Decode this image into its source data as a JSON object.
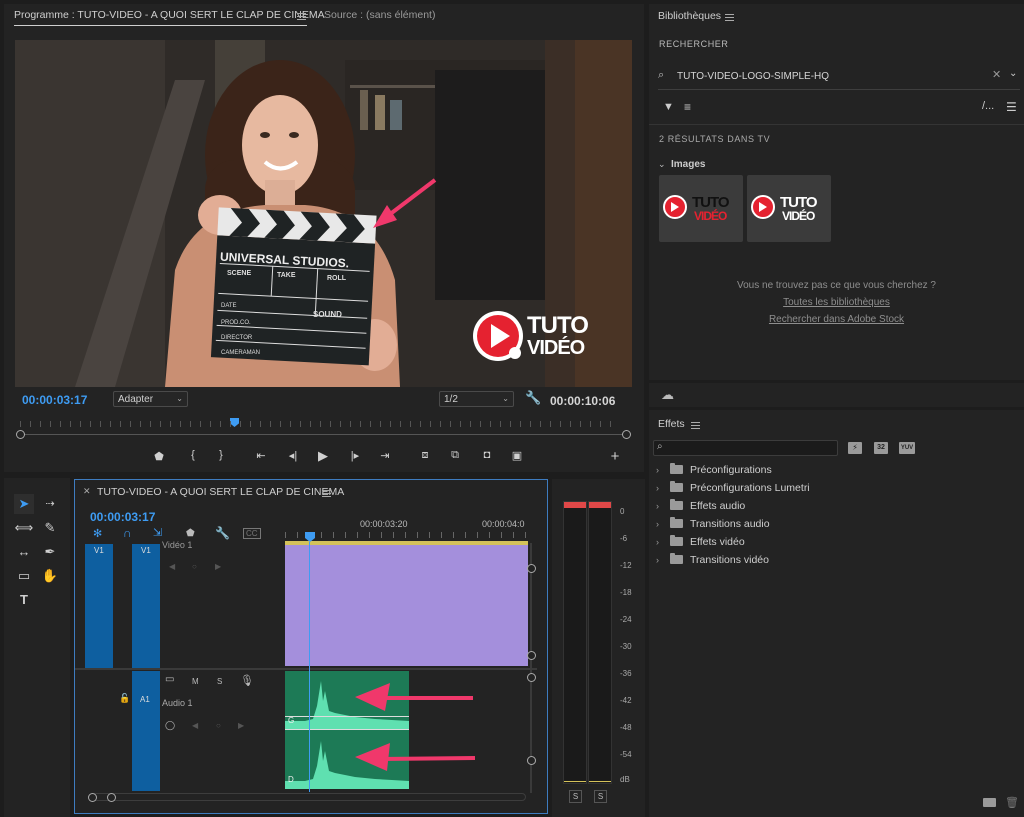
{
  "program_monitor": {
    "tab_program": "Programme : TUTO-VIDEO - A QUOI SERT LE CLAP DE CINEMA",
    "tab_source": "Source : (sans élément)",
    "timecode_current": "00:00:03:17",
    "zoom_select": "Adapter",
    "quality_select": "1/2",
    "timecode_duration": "00:00:10:06"
  },
  "video_frame": {
    "clapper_title": "UNIVERSAL STUDIOS.",
    "clapper_scene": "SCENE",
    "clapper_take": "TAKE",
    "clapper_roll": "ROLL",
    "clapper_date": "DATE",
    "clapper_sound": "SOUND",
    "clapper_prod": "PROD.CO.",
    "clapper_director": "DIRECTOR",
    "clapper_cameraman": "CAMERAMAN",
    "logo_line1": "TUTO",
    "logo_line2": "VIDÉO",
    "arrow_color": "#f0386b"
  },
  "libraries": {
    "title": "Bibliothèques",
    "search_heading": "RECHERCHER",
    "search_value": "TUTO-VIDEO-LOGO-SIMPLE-HQ",
    "results_count": "2 RÉSULTATS DANS TV",
    "section_images": "Images",
    "thumb_line1": "TUTO",
    "thumb_line2": "VIDÉO",
    "not_found": "Vous ne trouvez pas ce que vous cherchez ?",
    "link_all": "Toutes les bibliothèques",
    "link_stock": "Rechercher dans Adobe Stock"
  },
  "effects": {
    "title": "Effets",
    "badge_1": "32",
    "badge_2": "YUV",
    "items": [
      "Préconfigurations",
      "Préconfigurations Lumetri",
      "Effets audio",
      "Transitions audio",
      "Effets vidéo",
      "Transitions vidéo"
    ]
  },
  "timeline": {
    "tab_title": "TUTO-VIDEO - A QUOI SERT LE CLAP DE CINEMA",
    "timecode": "00:00:03:17",
    "ruler_1": "00:00:03:20",
    "ruler_2": "00:00:04:0",
    "track_v1_left": "V1",
    "track_v1_right": "V1",
    "video_track_name": "Vidéo 1",
    "track_a1": "A1",
    "audio_track_name": "Audio 1",
    "btn_m": "M",
    "btn_s": "S",
    "clip_label_g": "G",
    "clip_label_d": "D",
    "video_clip_color": "#a48fdc",
    "audio_clip_color": "#1d7a56",
    "waveform_color": "#5fe0b0"
  },
  "audio_meter": {
    "scale": [
      "0",
      "-6",
      "-12",
      "-18",
      "-24",
      "-30",
      "-36",
      "-42",
      "-48",
      "-54",
      "dB"
    ],
    "solo_left": "S",
    "solo_right": "S"
  },
  "colors": {
    "accent_blue": "#3e9cf3",
    "peak_red": "#e04848",
    "logo_red": "#e52230"
  }
}
